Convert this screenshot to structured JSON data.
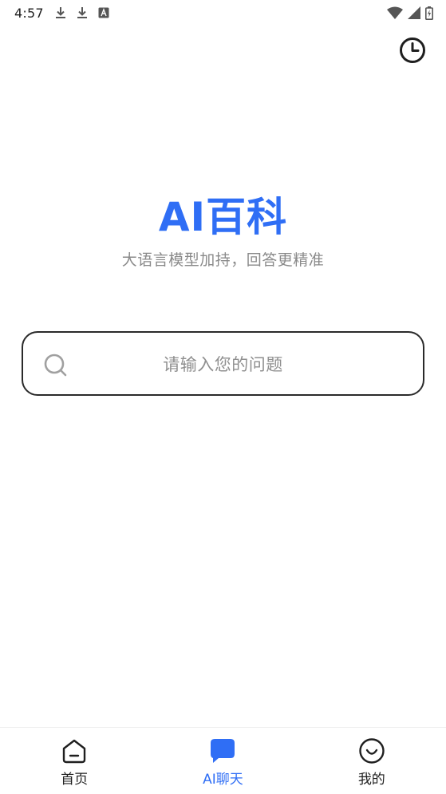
{
  "status_bar": {
    "time": "4:57",
    "icons": [
      "download-icon",
      "download-icon",
      "keyboard-a-icon",
      "wifi-icon",
      "signal-icon",
      "battery-icon"
    ]
  },
  "header": {
    "history_icon": "clock-icon"
  },
  "hero": {
    "title": "AI百科",
    "subtitle": "大语言模型加持，回答更精准"
  },
  "search": {
    "placeholder": "请输入您的问题",
    "icon": "search-icon"
  },
  "bottom_nav": {
    "items": [
      {
        "label": "首页",
        "icon": "home-icon",
        "active": false
      },
      {
        "label": "AI聊天",
        "icon": "chat-bubble-icon",
        "active": true
      },
      {
        "label": "我的",
        "icon": "smiley-face-icon",
        "active": false
      }
    ]
  },
  "colors": {
    "accent": "#2f6ef5",
    "text_primary": "#1f1f1f",
    "text_secondary": "#8a8a8a",
    "search_border": "#2a2a2a"
  }
}
